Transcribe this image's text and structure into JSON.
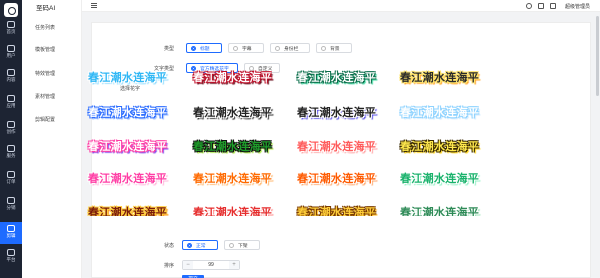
{
  "app": {
    "brand": "至码AI",
    "username": "超级管理员"
  },
  "rail": {
    "items": [
      {
        "label": "首页",
        "icon": "home-icon"
      },
      {
        "label": "用户",
        "icon": "user-icon"
      },
      {
        "label": "内容",
        "icon": "content-icon"
      },
      {
        "label": "应用",
        "icon": "app-icon"
      },
      {
        "label": "创作",
        "icon": "create-icon"
      },
      {
        "label": "服务",
        "icon": "diamond-icon"
      },
      {
        "label": "订单",
        "icon": "order-icon"
      },
      {
        "label": "分销",
        "icon": "share-icon"
      },
      {
        "label": "剪辑",
        "icon": "edit-icon",
        "active": true
      },
      {
        "label": "平台",
        "icon": "platform-icon"
      }
    ]
  },
  "subnav": [
    "任务列表",
    "模板管理",
    "特效管理",
    "素材管理",
    "剪辑配置"
  ],
  "topbar": {
    "icons": [
      "refresh-icon",
      "link-icon",
      "monitor-icon"
    ]
  },
  "form": {
    "type": {
      "label": "类型",
      "options": [
        "标题",
        "字幕",
        "身份栏",
        "背景"
      ],
      "selected": 0
    },
    "text_type": {
      "label": "文字类型",
      "options": [
        "官方精选花字",
        "自定义"
      ],
      "selected": 0
    },
    "choose_label": "选择花字",
    "sample_text": "春江潮水连海平",
    "status": {
      "label": "状态",
      "options": [
        "正常",
        "下架"
      ],
      "selected": 0
    },
    "sort": {
      "label": "排序",
      "value": "99",
      "minus": "−",
      "plus": "+"
    },
    "submit_label": "提交"
  },
  "styles": [
    {
      "color": "#2fb7f5",
      "stroke": "#ffffff",
      "shadow": "#8fdcff"
    },
    {
      "color": "#ffffff",
      "stroke": "#c0102a",
      "shadow": "#600010"
    },
    {
      "color": "#ffffff",
      "stroke": "#0a6e4a",
      "shadow": "#34d399"
    },
    {
      "color": "#2a2a2a",
      "stroke": "#ffe66d",
      "shadow": "#ff9f1c"
    },
    {
      "color": "#ffffff",
      "stroke": "#2b6cff",
      "shadow": "#8fb4ff"
    },
    {
      "color": "#222222",
      "stroke": "#ffffff",
      "shadow": "#222222"
    },
    {
      "color": "#222222",
      "stroke": "#ffffff",
      "shadow": "#4f46e5"
    },
    {
      "color": "#ffffff",
      "stroke": "#8fd3ff",
      "shadow": "#cde9ff"
    },
    {
      "color": "#ffffff",
      "stroke": "#ff3ea5",
      "shadow": "#7c3aed"
    },
    {
      "color": "#1f9d2b",
      "stroke": "#111111",
      "shadow": "#a3e635"
    },
    {
      "color": "#ff5a5a",
      "stroke": "#ffffff",
      "shadow": "#ff9f9f"
    },
    {
      "color": "#ffe94d",
      "stroke": "#3a2a00",
      "shadow": "#ffd000"
    },
    {
      "color": "#ff3ea5",
      "stroke": "#ffffff",
      "shadow": "#ffb3d9"
    },
    {
      "color": "#ff6a00",
      "stroke": "#ffffff",
      "shadow": "#ffb366"
    },
    {
      "color": "#ff5a00",
      "stroke": "#ffffff",
      "shadow": "#ffa366"
    },
    {
      "color": "#18b26b",
      "stroke": "#ffffff",
      "shadow": "#8ef0c3"
    },
    {
      "color": "#7a1a0a",
      "stroke": "#ffcf40",
      "shadow": "#ff8a00"
    },
    {
      "color": "#e62e2e",
      "stroke": "#ffffff",
      "shadow": "#ff8080"
    },
    {
      "color": "#ffce3a",
      "stroke": "#7a3b00",
      "shadow": "#ffb000"
    },
    {
      "color": "#2e8b57",
      "stroke": "#ffffff",
      "shadow": "#98e0b4"
    }
  ]
}
